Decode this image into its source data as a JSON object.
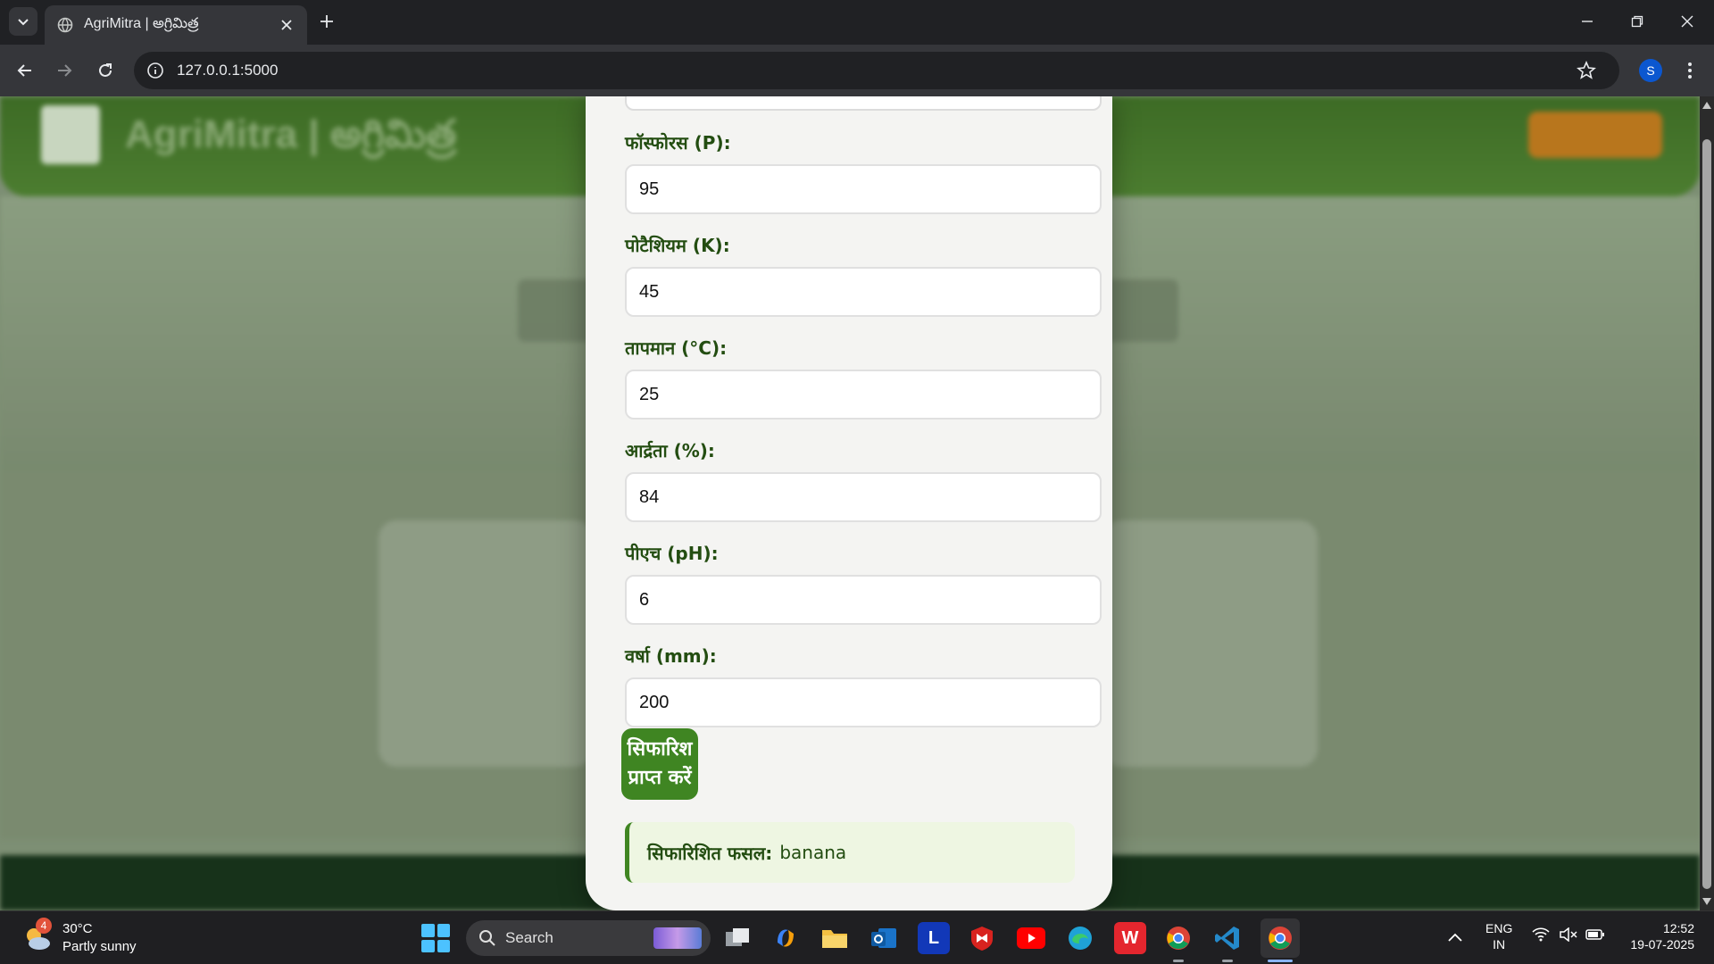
{
  "browser": {
    "tab_title": "AgriMitra | అగ్రిమిత్ర",
    "url": "127.0.0.1:5000",
    "profile_initial": "S"
  },
  "background_page": {
    "brand": "AgriMitra | అగ్రిమిత్ర"
  },
  "form": {
    "fields": [
      {
        "label": "फॉस्फोरस (P):",
        "value": "95"
      },
      {
        "label": "पोटैशियम (K):",
        "value": "45"
      },
      {
        "label": "तापमान (°C):",
        "value": "25"
      },
      {
        "label": "आर्द्रता (%):",
        "value": "84"
      },
      {
        "label": "पीएच (pH):",
        "value": "6"
      },
      {
        "label": "वर्षा (mm):",
        "value": "200"
      }
    ],
    "submit_label": "सिफारिश प्राप्त करें",
    "result_label": "सिफारिशित फसल:",
    "result_value": "banana"
  },
  "taskbar": {
    "weather_temp": "30°C",
    "weather_desc": "Partly sunny",
    "weather_badge": "4",
    "search_label": "Search",
    "lang_line1": "ENG",
    "lang_line2": "IN",
    "time": "12:52",
    "date": "19-07-2025"
  },
  "colors": {
    "accent_green": "#3f8522",
    "label_green": "#234d11"
  }
}
